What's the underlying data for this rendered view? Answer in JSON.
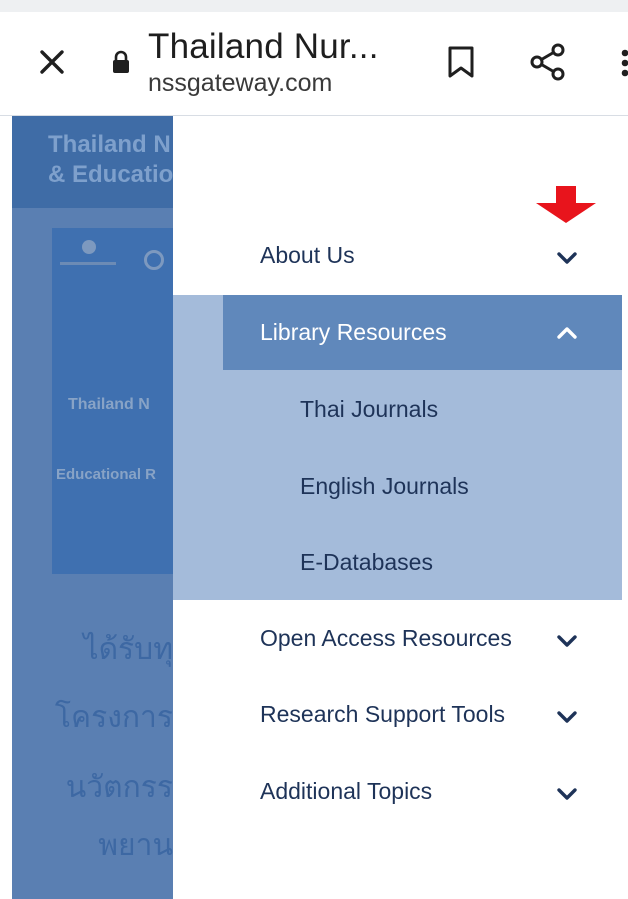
{
  "browser": {
    "title": "Thailand Nur...",
    "url": "nssgateway.com",
    "icons": {
      "close": "close-icon",
      "lock": "lock-icon",
      "bookmark": "bookmark-icon",
      "share": "share-icon",
      "more": "more-vert-icon"
    }
  },
  "background_page": {
    "header_text": "Thailand N\n& Educatio",
    "banner_line1": "Thailand  N",
    "banner_line2": "Educational R",
    "thai_lines": [
      "ได้รับทุ",
      "โครงการ",
      "นวัตกรร",
      "พยาน"
    ]
  },
  "menu": {
    "items": [
      {
        "label": "About Us",
        "expanded": false
      },
      {
        "label": "Library Resources",
        "expanded": true,
        "children": [
          "Thai Journals",
          "English Journals",
          "E-Databases"
        ]
      },
      {
        "label": "Open Access Resources",
        "expanded": false
      },
      {
        "label": "Research Support Tools",
        "expanded": false
      },
      {
        "label": "Additional Topics",
        "expanded": false
      }
    ]
  },
  "colors": {
    "drawer_bg": "#ffffff",
    "submenu_bg": "#a4bbda",
    "active_header": "#6088bb",
    "menu_text": "#1e3358",
    "annotation_arrow": "#e8141c",
    "page_overlay": "#5a7fb2"
  },
  "annotation": {
    "icon": "red-down-arrow"
  }
}
